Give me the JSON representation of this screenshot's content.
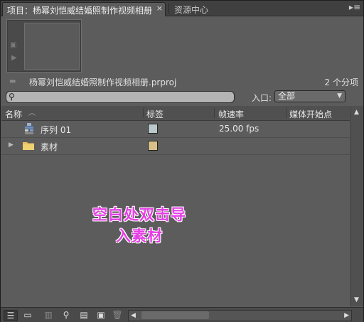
{
  "tabs": [
    {
      "label": "项目：杨幂刘恺威结婚照制作视频相册",
      "active": true
    },
    {
      "label": "资源中心",
      "active": false
    }
  ],
  "tab_menu": "▸≡",
  "project": {
    "filename": "杨幂刘恺威结婚照制作视频相册.prproj",
    "item_count": "2 个分项"
  },
  "search": {
    "placeholder": "",
    "value": ""
  },
  "entry": {
    "label": "入口:",
    "selected": "全部"
  },
  "columns": [
    "名称",
    "标签",
    "帧速率",
    "媒体开始点"
  ],
  "items": [
    {
      "name": "序列 01",
      "type": "sequence",
      "label_color": "#b9c8c8",
      "fps": "25.00 fps",
      "start": ""
    },
    {
      "name": "素材",
      "type": "bin",
      "label_color": "#d8c088",
      "fps": "",
      "start": ""
    }
  ],
  "overlay": {
    "line1": "空白处双击导",
    "line2": "入素材",
    "color": "#e63ee6"
  },
  "colors": {
    "panel": "#5c5c5c",
    "tab_bar": "#404040",
    "header": "#505050"
  }
}
